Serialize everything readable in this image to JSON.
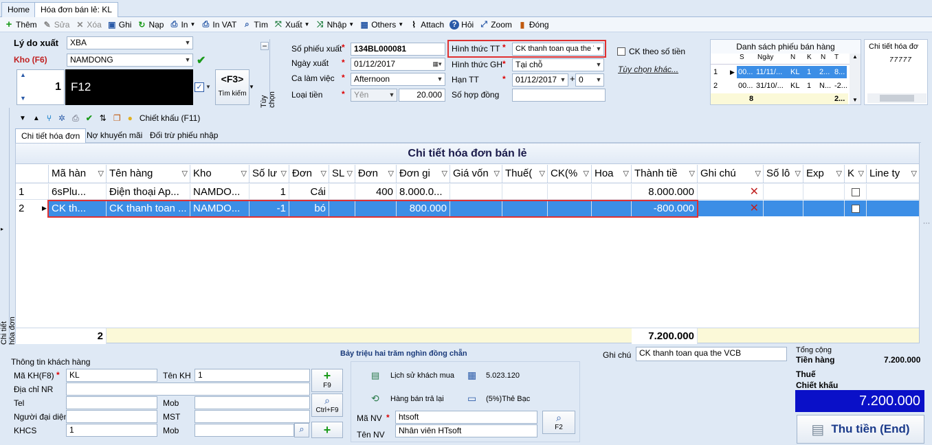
{
  "tabs": [
    {
      "label": "Home"
    },
    {
      "label": "Hóa đơn bán lẻ: KL"
    }
  ],
  "toolbar": [
    {
      "label": "Thêm",
      "icon": "plus-icon"
    },
    {
      "label": "Sửa",
      "icon": "pencil-icon"
    },
    {
      "label": "Xóa",
      "icon": "x-icon"
    },
    {
      "label": "Ghi",
      "icon": "save-icon"
    },
    {
      "label": "Nạp",
      "icon": "refresh-icon"
    },
    {
      "label": "In",
      "icon": "print-icon"
    },
    {
      "label": "In VAT",
      "icon": "print-icon"
    },
    {
      "label": "Tìm",
      "icon": "search-icon"
    },
    {
      "label": "Xuất",
      "icon": "export-icon"
    },
    {
      "label": "Nhập",
      "icon": "import-icon"
    },
    {
      "label": "Others",
      "icon": "grid-icon"
    },
    {
      "label": "Attach",
      "icon": "paperclip-icon"
    },
    {
      "label": "Hỏi",
      "icon": "help-icon"
    },
    {
      "label": "Zoom",
      "icon": "zoom-icon"
    },
    {
      "label": "Đóng",
      "icon": "close-icon"
    }
  ],
  "left_form": {
    "ly_do_label": "Lý do xuất",
    "ly_do_value": "XBA",
    "kho_label": "Kho (F6)",
    "kho_value": "NAMDONG",
    "qty_value": "1",
    "code_value": "F12",
    "f3_label": "<F3>",
    "tim_kiem": "Tìm kiếm",
    "tuy_chon": "Tùy chọn"
  },
  "mid_form": {
    "so_phieu_label": "Số phiếu xuất",
    "so_phieu_value": "134BL000081",
    "ngay_xuat_label": "Ngày xuất",
    "ngay_xuat_value": "01/12/2017",
    "ca_lam_label": "Ca làm việc",
    "ca_lam_value": "Afternoon",
    "loai_tien_label": "Loại tiền",
    "loai_tien_value": "Yên",
    "ty_gia_value": "20.000"
  },
  "right_form": {
    "hinh_thuc_tt_label": "Hình thức TT",
    "hinh_thuc_tt_value": "CK thanh toan qua the VCB",
    "hinh_thuc_gh_label": "Hình thức GH",
    "hinh_thuc_gh_value": "Tại chỗ",
    "han_tt_label": "Hạn TT",
    "han_tt_value": "01/12/2017",
    "han_tt_plus": "+",
    "han_tt_days": "0",
    "so_hop_dong_label": "Số hợp đồng",
    "ck_so_tien_label": "CK theo số tiền",
    "tuy_chon_khac": "Tùy chọn khác..."
  },
  "ds_phieu": {
    "title": "Danh sách phiếu bán hàng",
    "headers": [
      "S",
      "Ngày",
      "N",
      "K",
      "N",
      "T"
    ],
    "rows": [
      {
        "idx": "1",
        "s": "00...",
        "ngay": "11/11/...",
        "n": "KL",
        "k": "1",
        "n2": "2...",
        "t": "8..."
      },
      {
        "idx": "2",
        "s": "00...",
        "ngay": "31/10/...",
        "n": "KL",
        "k": "1",
        "n2": "N...",
        "t": "-2..."
      }
    ],
    "footer_count": "8",
    "footer_total": "2..."
  },
  "chi_tiet_hd": {
    "title": "Chi tiết hóa đơ",
    "value": "77777"
  },
  "subbar": {
    "chiet_khau": "Chiết khấu (F11)"
  },
  "subtabs": [
    {
      "label": "Chi tiết hóa đơn"
    },
    {
      "label": "Nợ khuyến mãi"
    },
    {
      "label": "Đối trừ phiếu nhập"
    }
  ],
  "side_label": "Chi tiết hóa đơn",
  "grid": {
    "title": "Chi tiết hóa đơn bán lẻ",
    "headers": [
      "Mã hàn",
      "Tên hàng",
      "Kho",
      "Số lư",
      "Đơn",
      "SL",
      "Đơn",
      "Đơn gi",
      "Giá vốn",
      "Thuế(",
      "CK(%",
      "Hoa",
      "Thành tiề",
      "Ghi chú",
      "Số lô",
      "Exp",
      "K",
      "Line ty"
    ],
    "rows": [
      {
        "idx": "1",
        "ma": "6sPlu...",
        "ten": "Điện thoại Ap...",
        "kho": "NAMDO...",
        "so_luong": "1",
        "don_vi": "Cái",
        "don2": "400",
        "don_gia": "8.000.0...",
        "thanh_tien": "8.000.000"
      },
      {
        "idx": "2",
        "ma": "CK th...",
        "ten": "CK thanh toan ...",
        "kho": "NAMDO...",
        "so_luong": "-1",
        "don_vi": "bó",
        "don2": "",
        "don_gia": "800.000",
        "thanh_tien": "-800.000"
      }
    ],
    "footer_count": "2",
    "footer_total": "7.200.000"
  },
  "bottom": {
    "amount_words": "Bảy triệu hai trăm nghìn đồng chẵn",
    "thong_tin": "Thông tin khách hàng",
    "ma_kh_label": "Mã KH(F8)",
    "ma_kh_value": "KL",
    "ten_kh_label": "Tên KH",
    "ten_kh_value": "1",
    "dia_chi_label": "Địa chỉ NR",
    "tel_label": "Tel",
    "mob_label": "Mob",
    "nguoi_dd_label": "Người đại diện",
    "mst_label": "MST",
    "khcs_label": "KHCS",
    "khcs_value": "1",
    "mob2_label": "Mob",
    "f9": "F9",
    "ctrl_f9": "Ctrl+F9",
    "lich_su": "Lịch sử khách mua",
    "lich_su_value": "5.023.120",
    "hang_ban_tra": "Hàng bán trả lại",
    "the_bac": "(5%)Thẻ Bạc",
    "ma_nv_label": "Mã NV",
    "ma_nv_value": "htsoft",
    "ten_nv_label": "Tên NV",
    "ten_nv_value": "Nhân viên HTsoft",
    "f2": "F2",
    "ghi_chu_label": "Ghi chú",
    "ghi_chu_value": "CK thanh toan qua the VCB",
    "tong_cong": "Tổng cộng",
    "tien_hang": "Tiền hàng",
    "tien_hang_value": "7.200.000",
    "thue": "Thuế",
    "chiet_khau": "Chiết khấu",
    "total_value": "7.200.000",
    "thu_tien": "Thu tiền (End)"
  }
}
